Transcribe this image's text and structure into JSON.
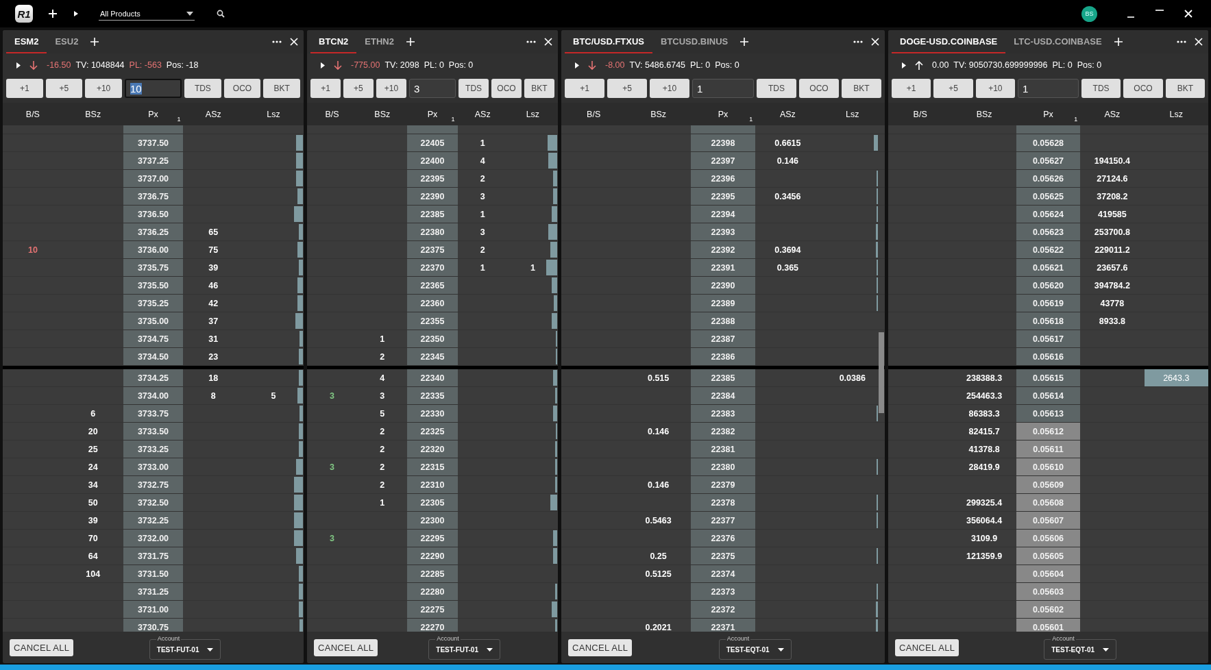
{
  "top_bar": {
    "logo": "R1",
    "product_filter": "All Products",
    "avatar": "BS"
  },
  "panels": [
    {
      "tabs": [
        {
          "label": "ESM2",
          "selected": true
        },
        {
          "label": "ESU2",
          "selected": false
        }
      ],
      "info": {
        "rising": false,
        "change": "-16.50",
        "tv": "TV: 1048844",
        "pl": "PL: -563",
        "pl_loss": true,
        "pos": "Pos: -18"
      },
      "quantity": {
        "value": "10",
        "focused": true
      },
      "buttons": [
        "+1",
        "+5",
        "+10"
      ],
      "order_buttons": [
        "TDS",
        "OCO",
        "BKT"
      ],
      "columns": [
        "B/S",
        "BSz",
        "Px",
        "ASz",
        "Lsz"
      ],
      "px_sub": "1",
      "scrollbar": false,
      "asks": [
        {
          "px": "3737.50"
        },
        {
          "px": "3737.25"
        },
        {
          "px": "3737.00"
        },
        {
          "px": "3736.75"
        },
        {
          "px": "3736.50"
        },
        {
          "px": "3736.25",
          "asz": "65"
        },
        {
          "bs": "10",
          "buy": false,
          "px": "3736.00",
          "asz": "75"
        },
        {
          "px": "3735.75",
          "asz": "39"
        },
        {
          "px": "3735.50",
          "asz": "46"
        },
        {
          "px": "3735.25",
          "asz": "42"
        },
        {
          "px": "3735.00",
          "asz": "37"
        },
        {
          "px": "3734.75",
          "asz": "31"
        },
        {
          "px": "3734.50",
          "asz": "23"
        }
      ],
      "bids": [
        {
          "px": "3734.25",
          "asz": "18"
        },
        {
          "px": "3734.00",
          "asz": "8",
          "lsz": "5"
        },
        {
          "bsz": "6",
          "px": "3733.75"
        },
        {
          "bsz": "20",
          "px": "3733.50"
        },
        {
          "bsz": "25",
          "px": "3733.25"
        },
        {
          "bsz": "24",
          "px": "3733.00"
        },
        {
          "bsz": "34",
          "px": "3732.75"
        },
        {
          "bsz": "50",
          "px": "3732.50"
        },
        {
          "bsz": "39",
          "px": "3732.25"
        },
        {
          "bsz": "70",
          "px": "3732.00"
        },
        {
          "bsz": "64",
          "px": "3731.75"
        },
        {
          "bsz": "104",
          "px": "3731.50"
        },
        {
          "px": "3731.25"
        },
        {
          "px": "3731.00"
        },
        {
          "px": "3730.75"
        }
      ],
      "cancel_label": "CANCEL ALL",
      "account": {
        "label": "Account",
        "value": "TEST-FUT-01"
      }
    },
    {
      "tabs": [
        {
          "label": "BTCN2",
          "selected": true
        },
        {
          "label": "ETHN2",
          "selected": false
        }
      ],
      "info": {
        "rising": false,
        "change": "-775.00",
        "tv": "TV: 2098",
        "pl": "PL: 0",
        "pl_loss": false,
        "pos": "Pos: 0"
      },
      "quantity": {
        "value": "3",
        "focused": false
      },
      "buttons": [
        "+1",
        "+5",
        "+10"
      ],
      "order_buttons": [
        "TDS",
        "OCO",
        "BKT"
      ],
      "columns": [
        "B/S",
        "BSz",
        "Px",
        "ASz",
        "Lsz"
      ],
      "px_sub": "1",
      "scrollbar": false,
      "asks": [
        {
          "px": "22405",
          "asz": "1"
        },
        {
          "px": "22400",
          "asz": "4"
        },
        {
          "px": "22395",
          "asz": "2"
        },
        {
          "px": "22390",
          "asz": "3"
        },
        {
          "px": "22385",
          "asz": "1"
        },
        {
          "px": "22380",
          "asz": "3"
        },
        {
          "px": "22375",
          "asz": "2"
        },
        {
          "px": "22370",
          "asz": "1",
          "lsz": "1"
        },
        {
          "px": "22365"
        },
        {
          "px": "22360"
        },
        {
          "px": "22355"
        },
        {
          "bsz": "1",
          "px": "22350"
        },
        {
          "bsz": "2",
          "px": "22345"
        }
      ],
      "bids": [
        {
          "bsz": "4",
          "px": "22340"
        },
        {
          "bs": "3",
          "buy": true,
          "bsz": "3",
          "px": "22335"
        },
        {
          "bsz": "5",
          "px": "22330"
        },
        {
          "bsz": "2",
          "px": "22325"
        },
        {
          "bsz": "2",
          "px": "22320"
        },
        {
          "bs": "3",
          "buy": true,
          "bsz": "2",
          "px": "22315"
        },
        {
          "bsz": "2",
          "px": "22310"
        },
        {
          "bsz": "1",
          "px": "22305"
        },
        {
          "px": "22300"
        },
        {
          "bs": "3",
          "buy": true,
          "px": "22295"
        },
        {
          "px": "22290"
        },
        {
          "px": "22285"
        },
        {
          "px": "22280"
        },
        {
          "px": "22275"
        },
        {
          "px": "22270"
        }
      ],
      "cancel_label": "CANCEL ALL",
      "account": {
        "label": "Account",
        "value": "TEST-FUT-01"
      }
    },
    {
      "tabs": [
        {
          "label": "BTC/USD.FTXUS",
          "selected": true
        },
        {
          "label": "BTCUSD.BINUS",
          "selected": false
        }
      ],
      "info": {
        "rising": false,
        "change": "-8.00",
        "tv": "TV: 5486.6745",
        "pl": "PL: 0",
        "pl_loss": false,
        "pos": "Pos: 0"
      },
      "quantity": {
        "value": "1",
        "focused": false
      },
      "buttons": [
        "+1",
        "+5",
        "+10"
      ],
      "order_buttons": [
        "TDS",
        "OCO",
        "BKT"
      ],
      "columns": [
        "B/S",
        "BSz",
        "Px",
        "ASz",
        "Lsz"
      ],
      "px_sub": "1",
      "scrollbar": true,
      "asks": [
        {
          "px": "22398",
          "asz": "0.6615"
        },
        {
          "px": "22397",
          "asz": "0.146"
        },
        {
          "px": "22396"
        },
        {
          "px": "22395",
          "asz": "0.3456"
        },
        {
          "px": "22394"
        },
        {
          "px": "22393"
        },
        {
          "px": "22392",
          "asz": "0.3694"
        },
        {
          "px": "22391",
          "asz": "0.365"
        },
        {
          "px": "22390"
        },
        {
          "px": "22389"
        },
        {
          "px": "22388"
        },
        {
          "px": "22387"
        },
        {
          "px": "22386"
        }
      ],
      "bids": [
        {
          "bsz": "0.515",
          "px": "22385",
          "lsz": "0.0386"
        },
        {
          "px": "22384"
        },
        {
          "px": "22383"
        },
        {
          "bsz": "0.146",
          "px": "22382"
        },
        {
          "px": "22381"
        },
        {
          "px": "22380"
        },
        {
          "bsz": "0.146",
          "px": "22379"
        },
        {
          "px": "22378"
        },
        {
          "bsz": "0.5463",
          "px": "22377"
        },
        {
          "px": "22376"
        },
        {
          "bsz": "0.25",
          "px": "22375"
        },
        {
          "bsz": "0.5125",
          "px": "22374"
        },
        {
          "px": "22373"
        },
        {
          "px": "22372"
        },
        {
          "bsz": "0.2021",
          "px": "22371"
        }
      ],
      "cancel_label": "CANCEL ALL",
      "account": {
        "label": "Account",
        "value": "TEST-EQT-01"
      }
    },
    {
      "tabs": [
        {
          "label": "DOGE-USD.COINBASE",
          "selected": true
        },
        {
          "label": "LTC-USD.COINBASE",
          "selected": false
        }
      ],
      "info": {
        "rising": true,
        "change": "0.00",
        "tv": "TV: 9050730.699999996",
        "pl": "PL: 0",
        "pl_loss": false,
        "pos": "Pos: 0"
      },
      "quantity": {
        "value": "1",
        "focused": false
      },
      "buttons": [
        "+1",
        "+5",
        "+10"
      ],
      "order_buttons": [
        "TDS",
        "OCO",
        "BKT"
      ],
      "columns": [
        "B/S",
        "BSz",
        "Px",
        "ASz",
        "Lsz"
      ],
      "px_sub": "1",
      "scrollbar": false,
      "asks": [
        {
          "px": "0.05628",
          "highlighted": false
        },
        {
          "px": "0.05627",
          "asz": "194150.4",
          "highlighted": false
        },
        {
          "px": "0.05626",
          "asz": "27124.6",
          "highlighted": false
        },
        {
          "px": "0.05625",
          "asz": "37208.2",
          "highlighted": false
        },
        {
          "px": "0.05624",
          "asz": "419585",
          "highlighted": false
        },
        {
          "px": "0.05623",
          "asz": "253700.8",
          "highlighted": false
        },
        {
          "px": "0.05622",
          "asz": "229011.2",
          "highlighted": false
        },
        {
          "px": "0.05621",
          "asz": "23657.6",
          "highlighted": false
        },
        {
          "px": "0.05620",
          "asz": "394784.2",
          "highlighted": false
        },
        {
          "px": "0.05619",
          "asz": "43778",
          "highlighted": false
        },
        {
          "px": "0.05618",
          "asz": "8933.8",
          "highlighted": false
        },
        {
          "px": "0.05617",
          "highlighted": false
        },
        {
          "px": "0.05616",
          "highlighted": false
        }
      ],
      "bids": [
        {
          "bsz": "238388.3",
          "px": "0.05615",
          "lsz": "2643.3",
          "lsz_highlighted": true,
          "highlighted": false
        },
        {
          "bsz": "254463.3",
          "px": "0.05614",
          "highlighted": false
        },
        {
          "bsz": "86383.3",
          "px": "0.05613",
          "highlighted": false
        },
        {
          "bsz": "82415.7",
          "px": "0.05612",
          "highlighted": true
        },
        {
          "bsz": "41378.8",
          "px": "0.05611",
          "highlighted": true
        },
        {
          "bsz": "28419.9",
          "px": "0.05610",
          "highlighted": true
        },
        {
          "px": "0.05609",
          "highlighted": true
        },
        {
          "bsz": "299325.4",
          "px": "0.05608",
          "highlighted": true
        },
        {
          "bsz": "356064.4",
          "px": "0.05607",
          "highlighted": true
        },
        {
          "bsz": "3109.9",
          "px": "0.05606",
          "highlighted": true
        },
        {
          "bsz": "121359.9",
          "px": "0.05605",
          "highlighted": true
        },
        {
          "px": "0.05604",
          "highlighted": true
        },
        {
          "px": "0.05603",
          "highlighted": true
        },
        {
          "px": "0.05602",
          "highlighted": true
        },
        {
          "px": "0.05601",
          "highlighted": true
        }
      ],
      "cancel_label": "CANCEL ALL",
      "account": {
        "label": "Account",
        "value": "TEST-EQT-01"
      }
    }
  ]
}
